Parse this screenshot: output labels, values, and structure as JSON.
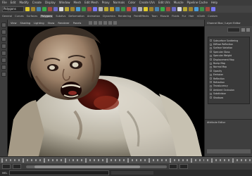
{
  "menubar": {
    "items": [
      "File",
      "Edit",
      "Modify",
      "Create",
      "Display",
      "Window",
      "Mesh",
      "Edit Mesh",
      "Proxy",
      "Normals",
      "Color",
      "Create UVs",
      "Edit UVs",
      "Muscle",
      "Pipeline Cache",
      "Help"
    ]
  },
  "toolbar": {
    "mode_select": "Polygons",
    "accent_colors": [
      "#e8d22a",
      "#c8a020",
      "#4aa0e0",
      "#3ab04a",
      "#d04a3a",
      "#7a7aff",
      "#e0e0e0"
    ]
  },
  "shelf": {
    "tabs": [
      "General",
      "Curves",
      "Surfaces",
      "Polygons",
      "Subdivs",
      "Deformation",
      "Animation",
      "Dynamics",
      "Rendering",
      "PaintEffects",
      "Toon",
      "Muscle",
      "Fluids",
      "Fur",
      "Hair",
      "nCloth",
      "Custom"
    ],
    "active_index": 3
  },
  "left_tools": [
    "select-tool",
    "lasso-tool",
    "paint-select-tool",
    "move-tool",
    "rotate-tool",
    "scale-tool",
    "manipulator-tool",
    "last-tool"
  ],
  "viewport": {
    "menu": [
      "View",
      "Shading",
      "Lighting",
      "Show",
      "Renderer",
      "Panels"
    ],
    "subject": "zombie-character-render"
  },
  "panel": {
    "tabs": [
      "Channel Box / Layer Editor"
    ],
    "attributes": [
      "Subsurface Scattering",
      "Diffuse Reflection",
      "Surface Variation",
      "Specular Gloss",
      "Specular Weight",
      "Displacement Map",
      "Bump Map",
      "Normal Map",
      "Opacity",
      "Emission",
      "Reflection",
      "Refraction",
      "Translucency",
      "Ambient Occlusion",
      "Subdivision",
      "Shadows"
    ],
    "bottom_title": "Attribute Editor"
  },
  "commandline": {
    "label": "MEL"
  }
}
